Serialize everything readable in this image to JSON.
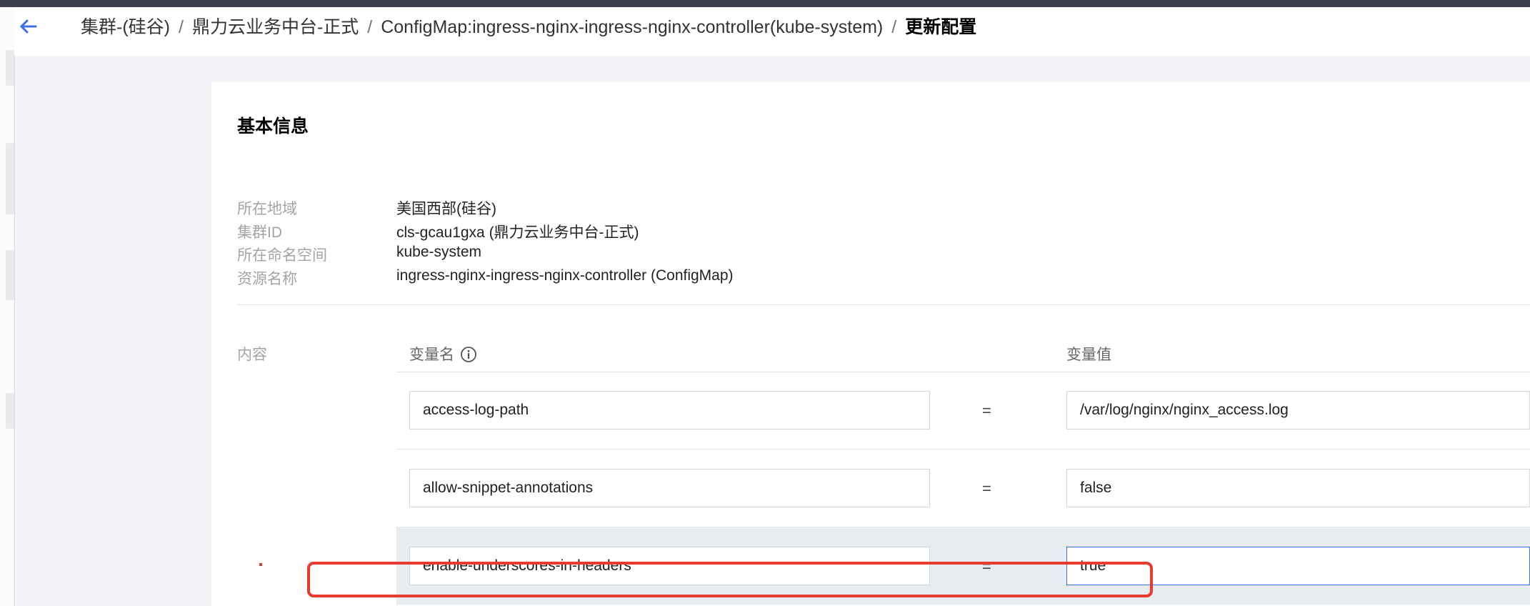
{
  "breadcrumb": {
    "items": [
      "集群-(硅谷)",
      "鼎力云业务中台-正式",
      "ConfigMap:ingress-nginx-ingress-nginx-controller(kube-system)"
    ],
    "current": "更新配置",
    "separator": "/"
  },
  "basic_info": {
    "title": "基本信息",
    "rows": [
      {
        "label": "所在地域",
        "value": "美国西部(硅谷)"
      },
      {
        "label": "集群ID",
        "value": "cls-gcau1gxa (鼎力云业务中台-正式)"
      },
      {
        "label": "所在命名空间",
        "value": "kube-system"
      },
      {
        "label": "资源名称",
        "value": "ingress-nginx-ingress-nginx-controller (ConfigMap)"
      }
    ]
  },
  "content": {
    "label": "内容",
    "name_header": "变量名",
    "value_header": "变量值",
    "equals": "=",
    "rows": [
      {
        "name": "access-log-path",
        "value": "/var/log/nginx/nginx_access.log"
      },
      {
        "name": "allow-snippet-annotations",
        "value": "false"
      },
      {
        "name": "enable-underscores-in-headers",
        "value": "true"
      }
    ]
  },
  "icons": {
    "back": "arrow-left-icon",
    "info": "info-circle-icon"
  },
  "colors": {
    "highlight": "#e63b2e",
    "focus_border": "#3d6fe0",
    "topbar": "#3b3f4e"
  }
}
